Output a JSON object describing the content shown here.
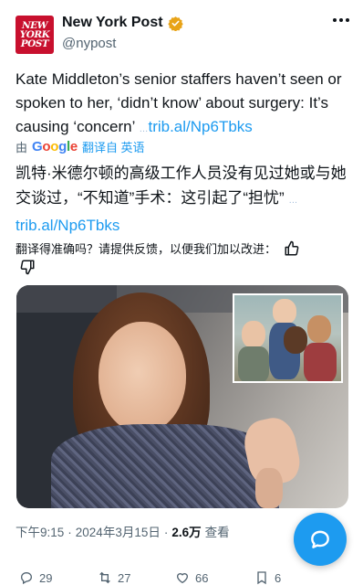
{
  "account": {
    "logo_lines": [
      "NEW",
      "YORK",
      "POST"
    ],
    "display_name": "New York Post",
    "handle": "@nypost",
    "verified_color": "#e8a317"
  },
  "tweet": {
    "text": "Kate Middleton’s senior staffers haven’t seen or spoken to her, ‘didn’t know’ about surgery: It’s causing ‘concern’",
    "link_prefix": "…",
    "link": "trib.al/Np6Tbks"
  },
  "translation_bar": {
    "prefix": "由",
    "provider": "Google",
    "suffix": "翻译自 英语"
  },
  "translation": {
    "text": "凯特·米德尔顿的高级工作人员没有见过她或与她交谈过，“不知道”手术：这引起了“担忧”",
    "link_prefix": "…",
    "link": "trib.al/Np6Tbks"
  },
  "feedback": {
    "question": "翻译得准确吗？请提供反馈，以便我们加以改进：",
    "up_icon": "thumbs-up-icon",
    "down_icon": "thumbs-down-icon"
  },
  "media": {
    "main_icon": "photo-woman-waving",
    "inset_icon": "photo-family-children"
  },
  "meta": {
    "time": "下午9:15",
    "separator": "·",
    "date": "2024年3月15日",
    "views_count": "2.6万",
    "views_label": "查看"
  },
  "actions": {
    "replies": "29",
    "retweets": "27",
    "likes": "66",
    "bookmarks": "6"
  },
  "fab": {
    "icon": "compose-reply-icon"
  },
  "colors": {
    "accent": "#1d9bf0",
    "brand_red": "#c8102e",
    "text": "#0f1419",
    "muted": "#536471"
  }
}
